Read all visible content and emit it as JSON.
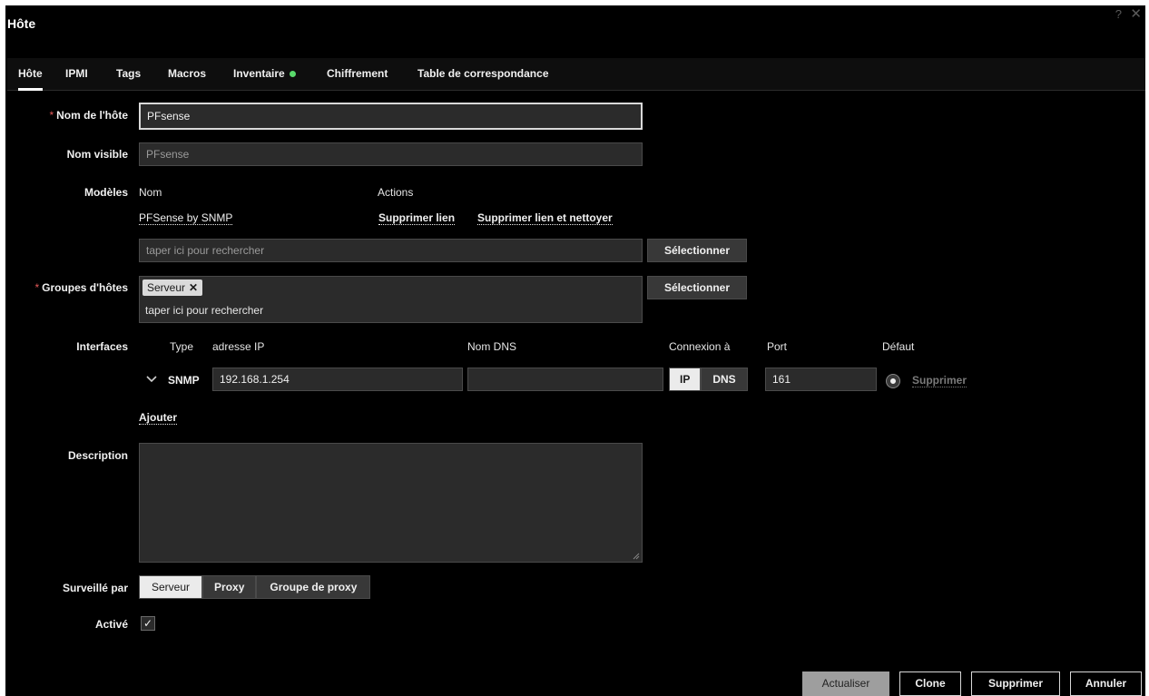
{
  "window": {
    "title": "Hôte",
    "help_icon": "question-icon",
    "close_icon": "close-icon"
  },
  "tabs": [
    {
      "label": "Hôte",
      "active": true
    },
    {
      "label": "IPMI"
    },
    {
      "label": "Tags"
    },
    {
      "label": "Macros"
    },
    {
      "label": "Inventaire",
      "indicator_color": "#59d96b"
    },
    {
      "label": "Chiffrement"
    },
    {
      "label": "Table de correspondance"
    }
  ],
  "form": {
    "host_name": {
      "label": "Nom de l'hôte",
      "value": "PFsense",
      "required_mark": "*"
    },
    "visible_name": {
      "label": "Nom visible",
      "value": "PFsense"
    },
    "templates": {
      "label": "Modèles",
      "col_name": "Nom",
      "col_actions": "Actions",
      "items": [
        {
          "name": "PFSense by SNMP",
          "unlink": "Supprimer lien",
          "unlink_clear": "Supprimer lien et nettoyer"
        }
      ],
      "search_placeholder": "taper ici pour rechercher",
      "select_button": "Sélectionner"
    },
    "host_groups": {
      "label": "Groupes d'hôtes",
      "required_mark": "*",
      "tags": [
        "Serveur"
      ],
      "remove_glyph": "✕",
      "search_placeholder": "taper ici pour rechercher",
      "select_button": "Sélectionner"
    },
    "interfaces": {
      "label": "Interfaces",
      "col_type": "Type",
      "col_ip": "adresse IP",
      "col_dns": "Nom DNS",
      "col_connect": "Connexion à",
      "col_port": "Port",
      "col_default": "Défaut",
      "rows": [
        {
          "type": "SNMP",
          "ip": "192.168.1.254",
          "dns": "",
          "connect_ip": "IP",
          "connect_dns": "DNS",
          "port": "161",
          "remove": "Supprimer"
        }
      ],
      "add_link": "Ajouter"
    },
    "description": {
      "label": "Description",
      "value": ""
    },
    "monitored_by": {
      "label": "Surveillé par",
      "options": [
        "Serveur",
        "Proxy",
        "Groupe de proxy"
      ],
      "selected": "Serveur"
    },
    "enabled": {
      "label": "Activé",
      "checked": true,
      "check_glyph": "✓"
    }
  },
  "footer": {
    "update": "Actualiser",
    "clone": "Clone",
    "delete": "Supprimer",
    "cancel": "Annuler"
  },
  "colors": {
    "background": "#000000",
    "input_bg": "#2b2b2b",
    "required": "#e45959",
    "accent_green": "#59d96b"
  }
}
